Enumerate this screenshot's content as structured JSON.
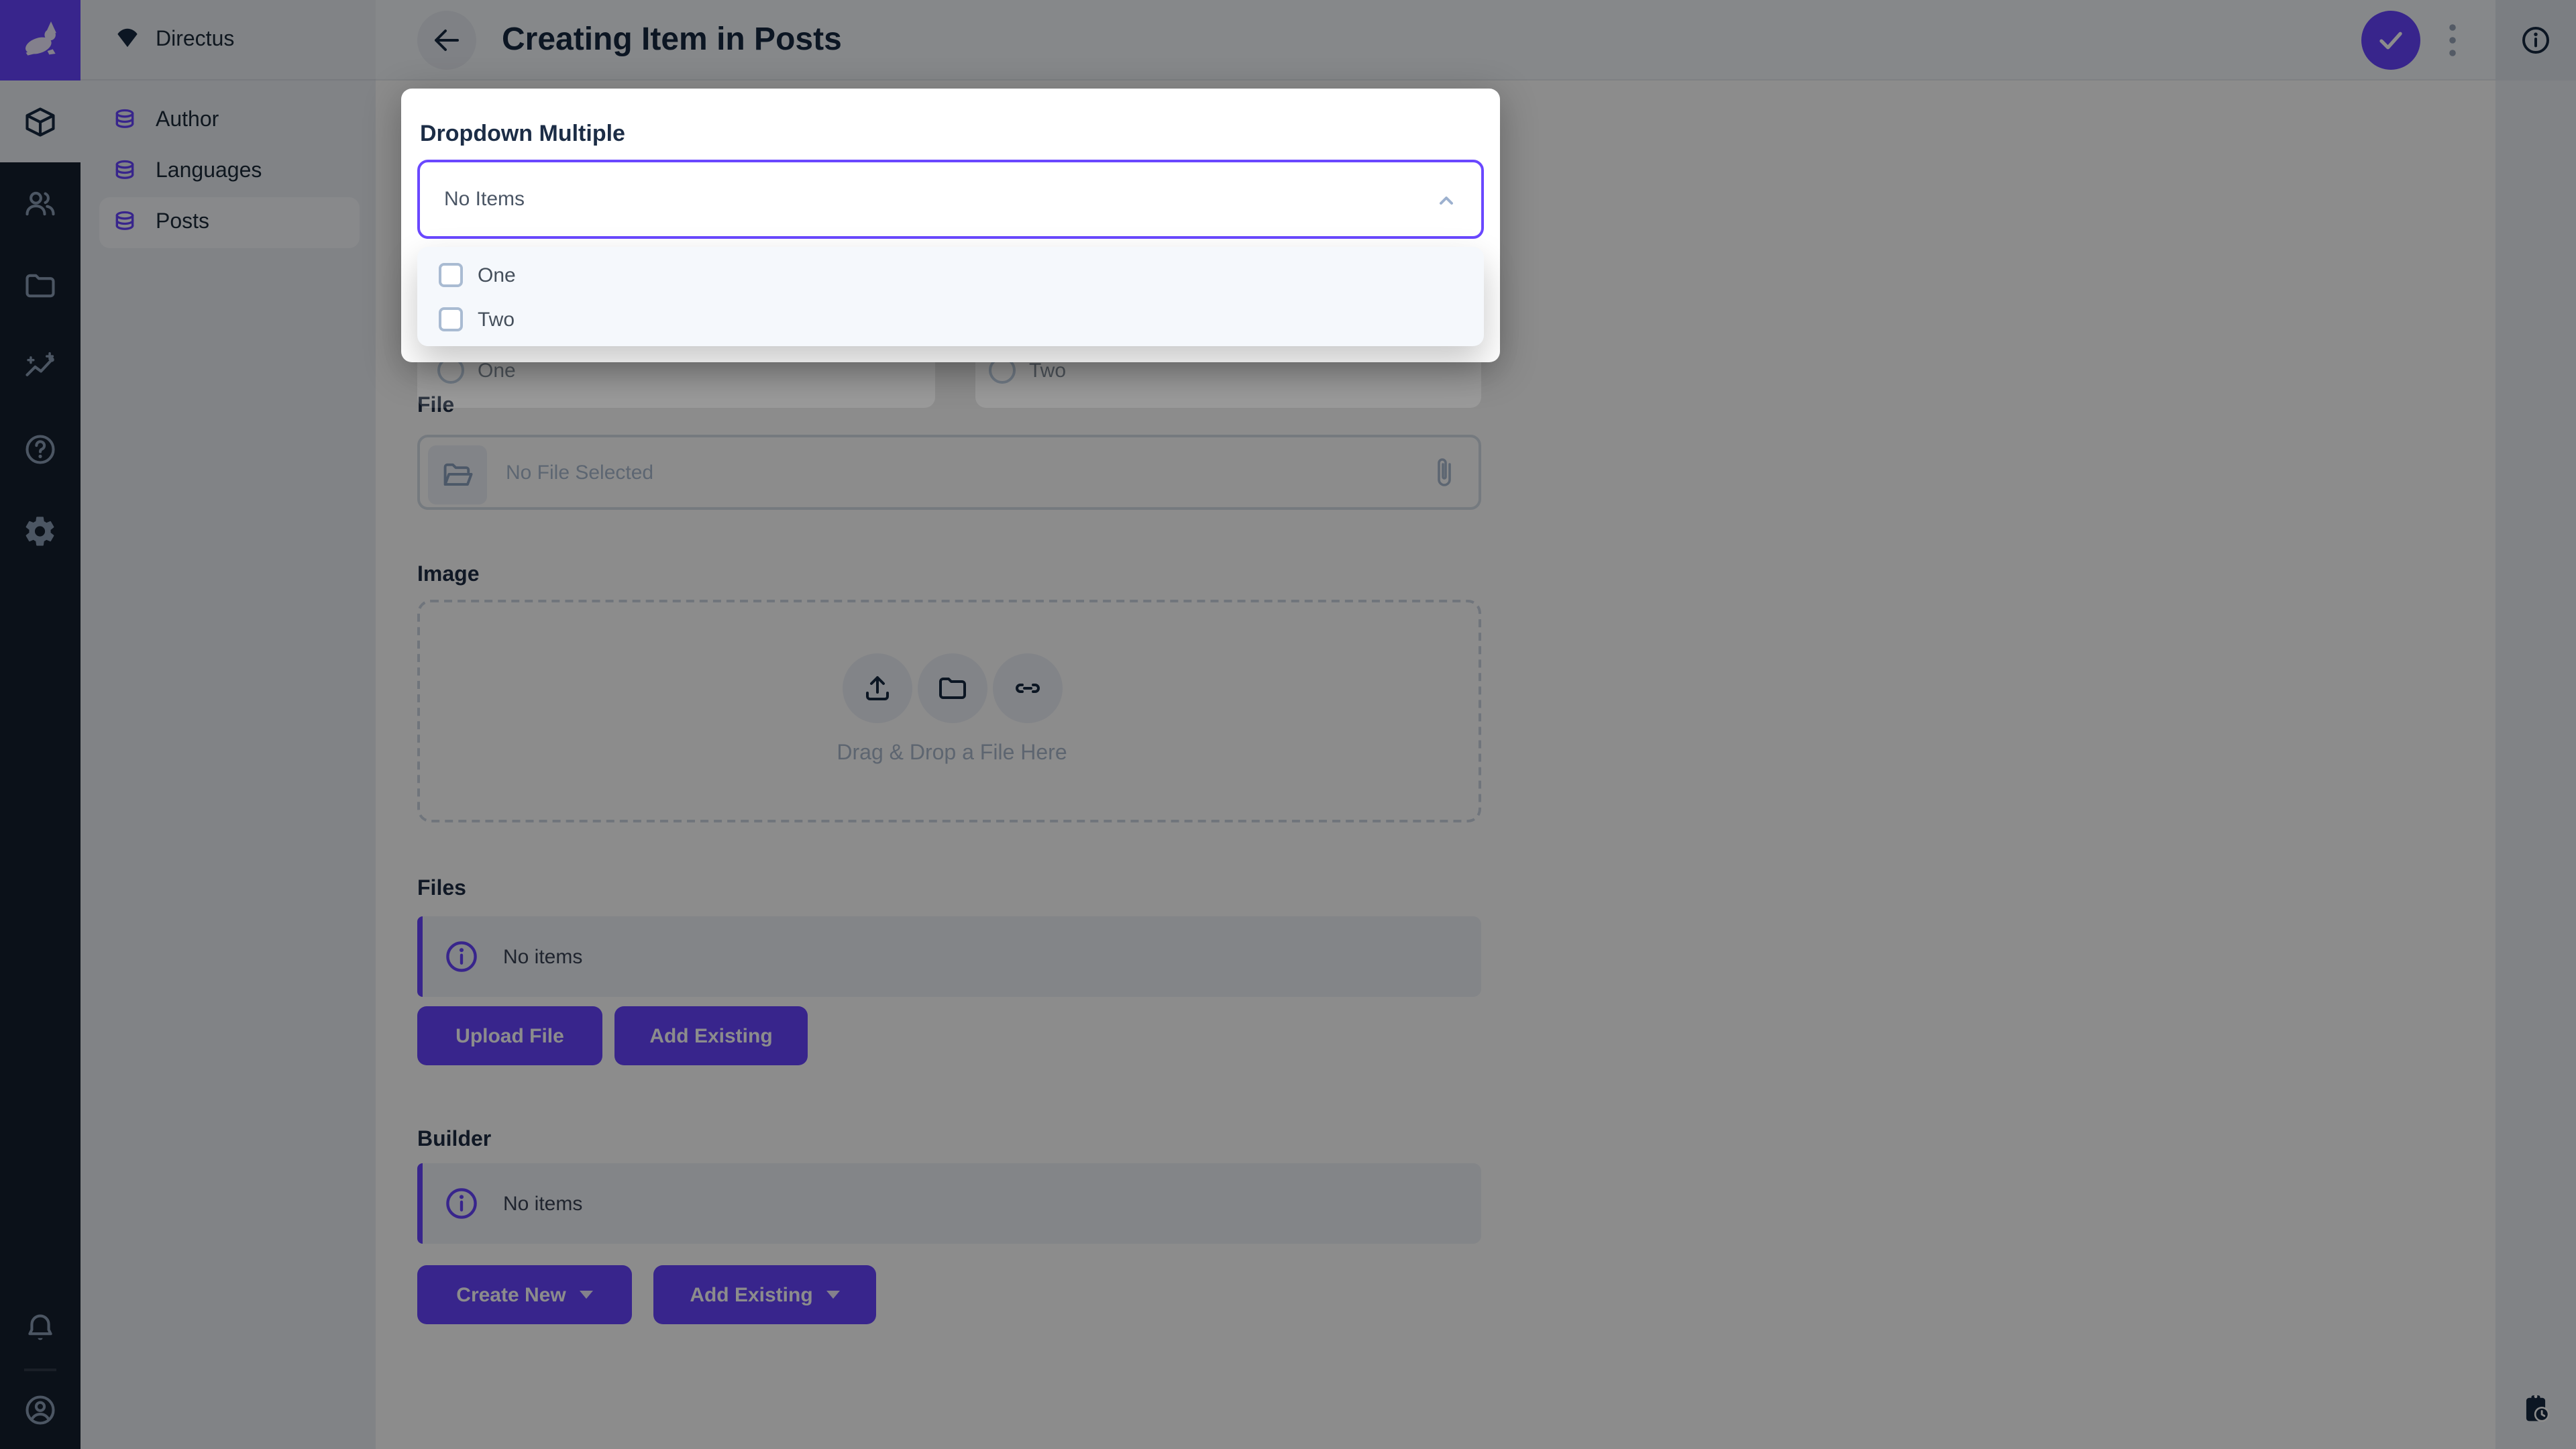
{
  "app": {
    "accent_color": "#6644ff",
    "navy": "#172940"
  },
  "nav": {
    "project": "Directus",
    "items": [
      {
        "label": "Author",
        "active": false
      },
      {
        "label": "Languages",
        "active": false
      },
      {
        "label": "Posts",
        "active": true
      }
    ]
  },
  "header": {
    "title": "Creating Item in Posts"
  },
  "dropdown_card": {
    "label": "Dropdown Multiple",
    "value": "No Items",
    "options": [
      {
        "label": "One",
        "checked": false
      },
      {
        "label": "Two",
        "checked": false
      }
    ]
  },
  "radio_field": {
    "options": [
      {
        "label": "One"
      },
      {
        "label": "Two"
      }
    ]
  },
  "file_field": {
    "label": "File",
    "placeholder": "No File Selected"
  },
  "image_field": {
    "label": "Image",
    "dropzone_text": "Drag & Drop a File Here"
  },
  "files_field": {
    "label": "Files",
    "notice": "No items",
    "upload_label": "Upload File",
    "add_existing_label": "Add Existing"
  },
  "builder_field": {
    "label": "Builder",
    "notice": "No items",
    "create_new_label": "Create New",
    "add_existing_label": "Add Existing"
  }
}
